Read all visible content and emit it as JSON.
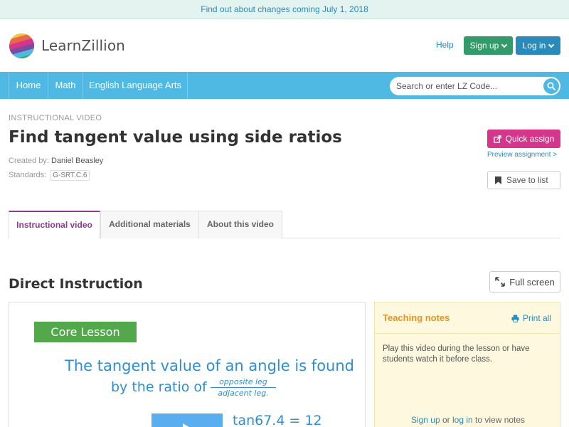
{
  "announcement": {
    "text": "Find out about changes coming July 1, 2018"
  },
  "header": {
    "brand": "LearnZillion",
    "help": "Help",
    "signup": "Sign up",
    "login": "Log in"
  },
  "nav": {
    "items": [
      {
        "label": "Home"
      },
      {
        "label": "Math"
      },
      {
        "label": "English Language Arts"
      }
    ],
    "search_placeholder": "Search or enter LZ Code..."
  },
  "lesson": {
    "eyebrow": "INSTRUCTIONAL VIDEO",
    "title": "Find tangent value using side ratios",
    "created_label": "Created by:",
    "author": "Daniel Beasley",
    "standards_label": "Standards:",
    "standard": "G-SRT.C.6",
    "quick_assign": "Quick assign",
    "preview": "Preview assignment >",
    "save": "Save to list"
  },
  "tabs": [
    {
      "label": "Instructional video",
      "active": true
    },
    {
      "label": "Additional materials",
      "active": false
    },
    {
      "label": "About this video",
      "active": false
    }
  ],
  "section": {
    "title": "Direct Instruction",
    "fullscreen": "Full screen"
  },
  "video": {
    "badge": "Core Lesson",
    "line1": "The tangent value of an angle is found",
    "line2": "by the ratio of",
    "frac_num": "opposite leg",
    "frac_den": "adjacent leg",
    "frac_dot": ".",
    "equation": "tan67.4 = 12"
  },
  "notes": {
    "title": "Teaching notes",
    "print": "Print all",
    "body": "Play this video during the lesson or have students watch it before class.",
    "signup": "Sign up",
    "or": " or ",
    "login": "log in",
    "suffix": " to view notes"
  },
  "colors": {
    "brand_blue": "#2a8ab9",
    "nav_blue": "#4fb8e3",
    "signup_green": "#339a6b",
    "assign_pink": "#d6358c",
    "tab_active_purple": "#8a3d8a",
    "notes_orange": "#e0952a"
  }
}
